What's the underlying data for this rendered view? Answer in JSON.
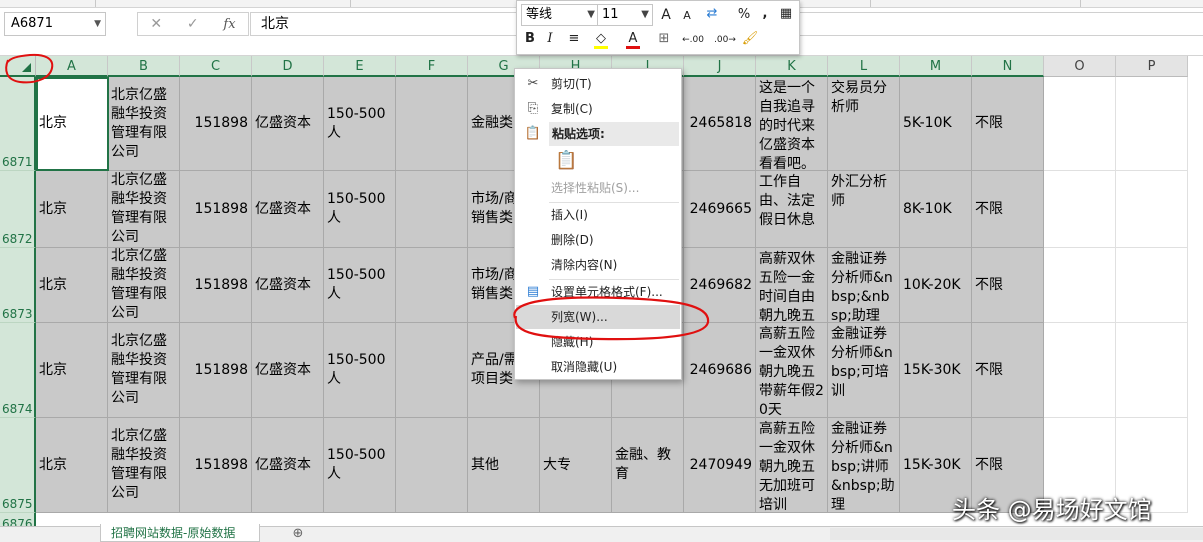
{
  "name_box": "A6871",
  "formula_value": "北京",
  "formula_icons": [
    "cancel-icon",
    "confirm-icon",
    "fx-icon"
  ],
  "columns": [
    "A",
    "B",
    "C",
    "D",
    "E",
    "F",
    "G",
    "H",
    "I",
    "J",
    "K",
    "L",
    "M",
    "N",
    "O",
    "P"
  ],
  "rows": [
    {
      "num": "6871",
      "A": "北京",
      "B": "北京亿盛融华投资管理有限公司",
      "C": "151898",
      "D": "亿盛资本",
      "E": "150-500人",
      "G": "金融类",
      "H": "",
      "I": "",
      "J": "2465818",
      "K": "这是一个自我追寻的时代来亿盛资本看看吧。",
      "L": "交易员分析师",
      "M": "5K-10K",
      "N": "不限"
    },
    {
      "num": "6872",
      "A": "北京",
      "B": "北京亿盛融华投资管理有限公司",
      "C": "151898",
      "D": "亿盛资本",
      "E": "150-500人",
      "G": "市场/商/销售类",
      "H": "",
      "I": "",
      "J": "2469665",
      "K": "工作自由、法定假日休息",
      "L": "外汇分析师",
      "M": "8K-10K",
      "N": "不限"
    },
    {
      "num": "6873",
      "A": "北京",
      "B": "北京亿盛融华投资管理有限公司",
      "C": "151898",
      "D": "亿盛资本",
      "E": "150-500人",
      "G": "市场/商/销售类",
      "H": "",
      "I": "",
      "J": "2469682",
      "K": "高薪双休五险一金时间自由朝九晚五",
      "L": "金融证券分析师&nbsp;&nbsp;助理",
      "M": "10K-20K",
      "N": "不限"
    },
    {
      "num": "6874",
      "A": "北京",
      "B": "北京亿盛融华投资管理有限公司",
      "C": "151898",
      "D": "亿盛资本",
      "E": "150-500人",
      "G": "产品/需/项目类",
      "H": "",
      "I": "育",
      "J": "2469686",
      "K": "高薪五险一金双休朝九晚五带薪年假20天",
      "L": "金融证券分析师&nbsp;可培训",
      "M": "15K-30K",
      "N": "不限"
    },
    {
      "num": "6875",
      "A": "北京",
      "B": "北京亿盛融华投资管理有限公司",
      "C": "151898",
      "D": "亿盛资本",
      "E": "150-500人",
      "G": "其他",
      "H": "大专",
      "I": "金融、教育",
      "J": "2470949",
      "K": "高薪五险一金双休朝九晚五无加班可培训",
      "L": "金融证券分析师&nbsp;讲师&nbsp;助理",
      "M": "15K-30K",
      "N": "不限"
    },
    {
      "num": "6876"
    }
  ],
  "mini_toolbar": {
    "font_name": "等线",
    "font_size": "11",
    "grow_font": "A",
    "shrink_font": "A",
    "percent": "%",
    "comma": ",",
    "bold": "B",
    "italic": "I",
    "font_color_letter": "A",
    "decimal_more": "←.00",
    "decimal_less": ".00→",
    "icons": [
      "align-center-icon",
      "fill-color-icon",
      "border-icon",
      "format-painter-icon",
      "number-format-icon",
      "merge-icon"
    ]
  },
  "context_menu": {
    "cut": "剪切(T)",
    "copy": "复制(C)",
    "paste_options": "粘贴选项:",
    "paste_special": "选择性粘贴(S)...",
    "insert": "插入(I)",
    "delete": "删除(D)",
    "clear": "清除内容(N)",
    "format_cells": "设置单元格格式(F)...",
    "column_width": "列宽(W)...",
    "hide": "隐藏(H)",
    "unhide": "取消隐藏(U)"
  },
  "sheet_tab": "招聘网站数据-原始数据",
  "add_sheet": "⊕",
  "watermark": "头条 @易场好文馆",
  "colors": {
    "accent": "#217346",
    "annotation": "#e01010",
    "selected_fill": "#c9c9c9"
  }
}
